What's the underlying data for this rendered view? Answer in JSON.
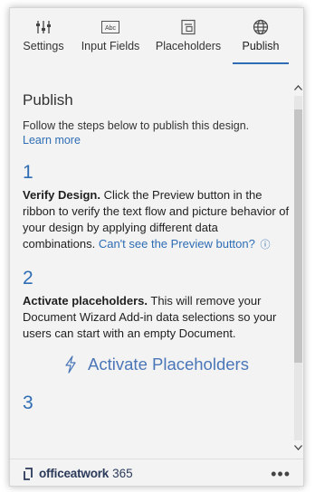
{
  "tabs": [
    {
      "label": "Settings",
      "icon": "settings-sliders-icon"
    },
    {
      "label": "Input Fields",
      "icon": "input-field-icon",
      "icon_text": "Abc"
    },
    {
      "label": "Placeholders",
      "icon": "placeholder-icon"
    },
    {
      "label": "Publish",
      "icon": "globe-icon",
      "active": true
    }
  ],
  "page": {
    "title": "Publish",
    "intro": "Follow the steps below to publish this design.",
    "learn_more": "Learn more"
  },
  "steps": [
    {
      "number": "1",
      "title": "Verify Design.",
      "body": " Click the Preview button in the ribbon to verify the text flow and picture behavior of your design by applying different data combinations. ",
      "link": "Can't see the Preview button?",
      "info": "ⓘ"
    },
    {
      "number": "2",
      "title": "Activate placeholders.",
      "body": " This will remove your Document Wizard Add-in data selections so your users can start with an empty Document."
    },
    {
      "number": "3"
    }
  ],
  "action": {
    "label": "Activate Placeholders",
    "icon": "lightning-icon"
  },
  "footer": {
    "brand": "officeatwork",
    "suffix": "365",
    "more": "•••"
  },
  "colors": {
    "accent": "#2e6db4",
    "background": "#f3f3f3",
    "text": "#1f1f1f"
  }
}
